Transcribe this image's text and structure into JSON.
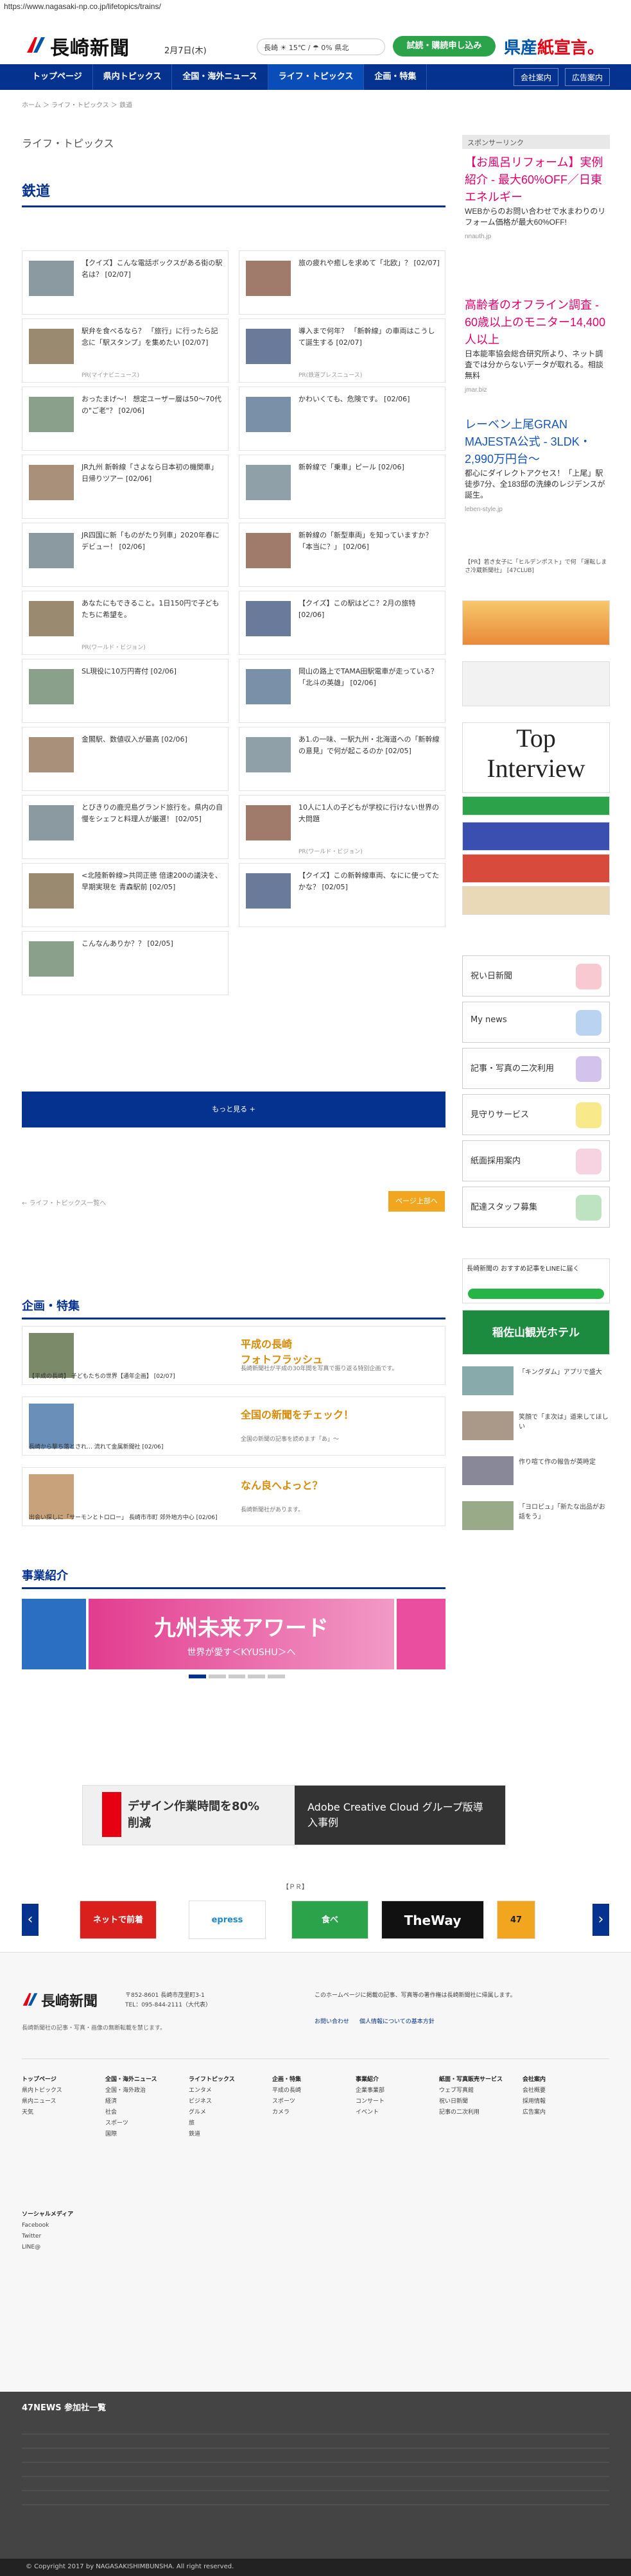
{
  "url": "https://www.nagasaki-np.co.jp/lifetopics/trains/",
  "header": {
    "logo": "長崎新聞",
    "date": "2月7日(木)",
    "weather": "長崎 ☀ 15℃ / ☂ 0% 県北",
    "trial_button": "試読・購読申し込み",
    "kensan_a": "県産",
    "kensan_b": "紙宣言。"
  },
  "nav": {
    "items": [
      "トップページ",
      "県内トピックス",
      "全国・海外ニュース",
      "ライフ・トピックス",
      "企画・特集"
    ],
    "active": 3,
    "company": "会社案内",
    "ad": "広告案内"
  },
  "breadcrumb": "ホーム ＞ ライフ・トピックス ＞ 鉄道",
  "category_heading": "ライフ・トピックス",
  "section_title": "鉄道",
  "articles": [
    {
      "title": "【クイズ】こんな電話ボックスがある街の駅名は？ [02/07]",
      "source": ""
    },
    {
      "title": "旅の疲れや癒しを求めて「北欧」？ [02/07]",
      "source": ""
    },
    {
      "title": "駅弁を食べるなら？ 「旅行」に行ったら記念に「駅スタンプ」を集めたい [02/07]",
      "source": "PR(マイナビニュース)"
    },
    {
      "title": "導入まで何年？ 「新幹線」の車両はこうして誕生する [02/07]",
      "source": "PR(鉄道プレスニュース)"
    },
    {
      "title": "おったまげ～！ 想定ユーザー層は50〜70代の\"ご老\"？ [02/06]",
      "source": ""
    },
    {
      "title": "かわいくても、危険です。 [02/06]",
      "source": ""
    },
    {
      "title": "JR九州 新幹線「さよなら日本初の機関車」日帰りツアー [02/06]",
      "source": ""
    },
    {
      "title": "新幹線で「乗車」ピール [02/06]",
      "source": ""
    },
    {
      "title": "JR四国に新「ものがたり列車」2020年春にデビュー！ [02/06]",
      "source": ""
    },
    {
      "title": "新幹線の「新型車両」を知っていますか？ 「本当に？」 [02/06]",
      "source": ""
    },
    {
      "title": "あなたにもできること。1日150円で子どもたちに希望を。",
      "source": "PR(ワールド・ビジョン)"
    },
    {
      "title": "【クイズ】この駅はどこ？2月の旅特 [02/06]",
      "source": ""
    },
    {
      "title": "SL現役に10万円寄付 [02/06]",
      "source": ""
    },
    {
      "title": "岡山の路上でTAMA田駅電車が走っている？ 「北斗の英雄」 [02/06]",
      "source": ""
    },
    {
      "title": "金閣駅、数値収入が最高 [02/06]",
      "source": ""
    },
    {
      "title": "あ1.の一味、一駅九州・北海道への「新幹線の意見」で何が起こるのか [02/05]",
      "source": ""
    },
    {
      "title": "とびきりの鹿児島グランド旅行を。県内の自慢をシェフと料理人が厳選！ [02/05]",
      "source": ""
    },
    {
      "title": "10人に1人の子どもが学校に行けない世界の大問題",
      "source": "PR(ワールド・ビジョン)"
    },
    {
      "title": "<北陸新幹線>共同正徳 倍速200の議決を、早期実現を 青森駅前 [02/05]",
      "source": ""
    },
    {
      "title": "【クイズ】この新幹線車両、なにに使ってたかな？ [02/05]",
      "source": ""
    },
    {
      "title": "こんなんありか？？ [02/05]",
      "source": ""
    }
  ],
  "more_button": "もっと見る +",
  "back_link": "← ライフ・トピックス一覧へ",
  "page_top": "ページ上部へ",
  "features_heading": "企画・特集",
  "features": [
    {
      "caption": "【平成の長崎】 子どもたちの世界【通年企画】 [02/07]",
      "name": "平成の長崎\nフォトフラッシュ",
      "desc": "長崎新聞社が平成の30年間を写真で振り返る特別企画です。"
    },
    {
      "caption": "長崎から撃ち落とされ… 流れて金属新聞社 [02/06]",
      "name": "全国の新聞をチェック！",
      "desc": "全国の新聞の記事を読めます「あ」〜"
    },
    {
      "caption": "出会い探しに「サーモンとトロロー」 長崎市市町 郊外地方中心 [02/06]",
      "name": "なん良へよっと？",
      "desc": "長崎新聞社があります。"
    }
  ],
  "biz_heading": "事業紹介",
  "biz_banner": "九州未来アワード",
  "biz_banner_sub": "世界が愛す＜KYUSHU＞へ",
  "sidebar": {
    "sponsor_heading": "スポンサーリンク",
    "ads": [
      {
        "title": "【お風呂リフォーム】実例紹介 - 最大60%OFF／日東エネルギー",
        "desc": "WEBからのお問い合わせで水まわりのリフォーム価格が最大60%OFF!",
        "url": "nnauth.jp"
      },
      {
        "title": "高齢者のオフライン調査 - 60歳以上のモニター14,400人以上",
        "desc": "日本能率協会総合研究所より、ネット調査では分からないデータが取れる。相談無料",
        "url": "jmar.biz"
      },
      {
        "title": "レーベン上尾GRAN MAJESTA公式 - 3LDK・2,990万円台〜",
        "desc": "都心にダイレクトアクセス！「上尾」駅徒歩7分、全183邸の洗練のレジデンスが誕生。",
        "url": "leben-style.jp"
      }
    ],
    "promo_text": "【PR】若き女子に「ヒルデンポスト」で何 「運転しまさ冷蔵新聞社」 [47CLUB]",
    "services": [
      "祝い日新聞",
      "My news",
      "記事・写真の二次利用",
      "見守りサービス",
      "紙面採用案内",
      "配達スタッフ募集"
    ],
    "line_banner": "長崎新聞の おすすめ記事をLINEに届く",
    "kanko_banner": "稲佐山観光ホテル",
    "news": [
      {
        "text": "「キングダム」アプリで盛大"
      },
      {
        "text": "笑顔で「ま次は」道来してほしい"
      },
      {
        "text": "作り喧て作の報告が英時定"
      },
      {
        "text": "「ヨロピュ」「新たな出品がお話をう」"
      }
    ]
  },
  "ad_bottom": {
    "left": "デザイン作業時間を80%削減",
    "right": "Adobe Creative Cloud グループ版導入事例"
  },
  "carousel_heading": "【ＰＲ】",
  "carousel": [
    "ネットで前着",
    "epress",
    "食べ",
    "TheWay",
    "47"
  ],
  "footer": {
    "address": "〒852-8601 長崎市茂里町3-1 TEL：095-844-2111（大代表）",
    "note": "長崎新聞社の記事・写真・画像の無断転載を禁じます。",
    "privacy": "このホームページに掲載の記事、写真等の著作権は長崎新聞社に帰属します。",
    "links": [
      "お問い合わせ",
      "個人情報についての基本方針"
    ],
    "columns": [
      {
        "heading": "トップページ",
        "items": [
          "県内トピックス",
          "県内ニュース",
          "天気"
        ]
      },
      {
        "heading": "全国・海外ニュース",
        "items": [
          "全国・海外政治",
          "経済",
          "社会",
          "スポーツ",
          "国際"
        ]
      },
      {
        "heading": "ライフトピックス",
        "items": [
          "エンタメ",
          "ビジネス",
          "グルメ",
          "旅",
          "鉄道"
        ]
      },
      {
        "heading": "企画・特集",
        "items": [
          "平成の長崎",
          "スポーツ",
          "カメラ"
        ]
      },
      {
        "heading": "事業紹介",
        "items": [
          "企業事業部",
          "コンサート",
          "イベント"
        ]
      },
      {
        "heading": "紙面・写真販売サービス",
        "items": [
          "ウェブ写真館",
          "祝い日新聞",
          "記事の二次利用"
        ]
      },
      {
        "heading": "会社案内",
        "items": [
          "会社概要",
          "採用情報",
          "広告案内"
        ]
      }
    ],
    "social": [
      "ソーシャルメディア",
      "Facebook",
      "Twitter",
      "LINE@"
    ]
  },
  "footer47": {
    "heading": "47NEWS 参加社一覧"
  },
  "copyright": "© Copyright 2017 by NAGASAKISHIMBUNSHA. All right reserved."
}
